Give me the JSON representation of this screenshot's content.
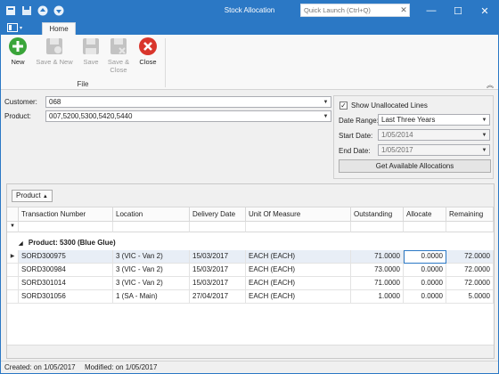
{
  "window": {
    "title": "Stock Allocation",
    "quick_launch_placeholder": "Quick Launch (Ctrl+Q)"
  },
  "ribbon": {
    "tab": "Home",
    "buttons": {
      "new": "New",
      "save_new": "Save & New",
      "save": "Save",
      "save_close": "Save & Close",
      "close": "Close"
    },
    "group": "File"
  },
  "form": {
    "customer_label": "Customer:",
    "customer_value": "068",
    "product_label": "Product:",
    "product_value": "007,5200,5300,5420,5440",
    "show_unallocated_label": "Show Unallocated Lines",
    "show_unallocated_checked": true,
    "date_range_label": "Date Range:",
    "date_range_value": "Last Three Years",
    "start_date_label": "Start Date:",
    "start_date_value": "1/05/2014",
    "end_date_label": "End Date:",
    "end_date_value": "1/05/2017",
    "get_allocations_label": "Get Available Allocations"
  },
  "grid": {
    "group_chip": "Product",
    "columns": [
      "Transaction Number",
      "Location",
      "Delivery Date",
      "Unit Of Measure",
      "Outstanding",
      "Allocate",
      "Remaining"
    ],
    "group_row": "Product: 5300 (Blue Glue)",
    "rows": [
      [
        "SORD300975",
        "3 (VIC - Van 2)",
        "15/03/2017",
        "EACH (EACH)",
        "71.0000",
        "0.0000",
        "72.0000"
      ],
      [
        "SORD300984",
        "3 (VIC - Van 2)",
        "15/03/2017",
        "EACH (EACH)",
        "73.0000",
        "0.0000",
        "72.0000"
      ],
      [
        "SORD301014",
        "3 (VIC - Van 2)",
        "15/03/2017",
        "EACH (EACH)",
        "71.0000",
        "0.0000",
        "72.0000"
      ],
      [
        "SORD301056",
        "1 (SA - Main)",
        "27/04/2017",
        "EACH (EACH)",
        "1.0000",
        "0.0000",
        "5.0000"
      ]
    ]
  },
  "status": {
    "created": "Created:  on 1/05/2017",
    "modified": "Modified:  on 1/05/2017"
  },
  "colors": {
    "accent": "#2b78c5",
    "close_red": "#d9362c",
    "new_green": "#3aa53a"
  }
}
